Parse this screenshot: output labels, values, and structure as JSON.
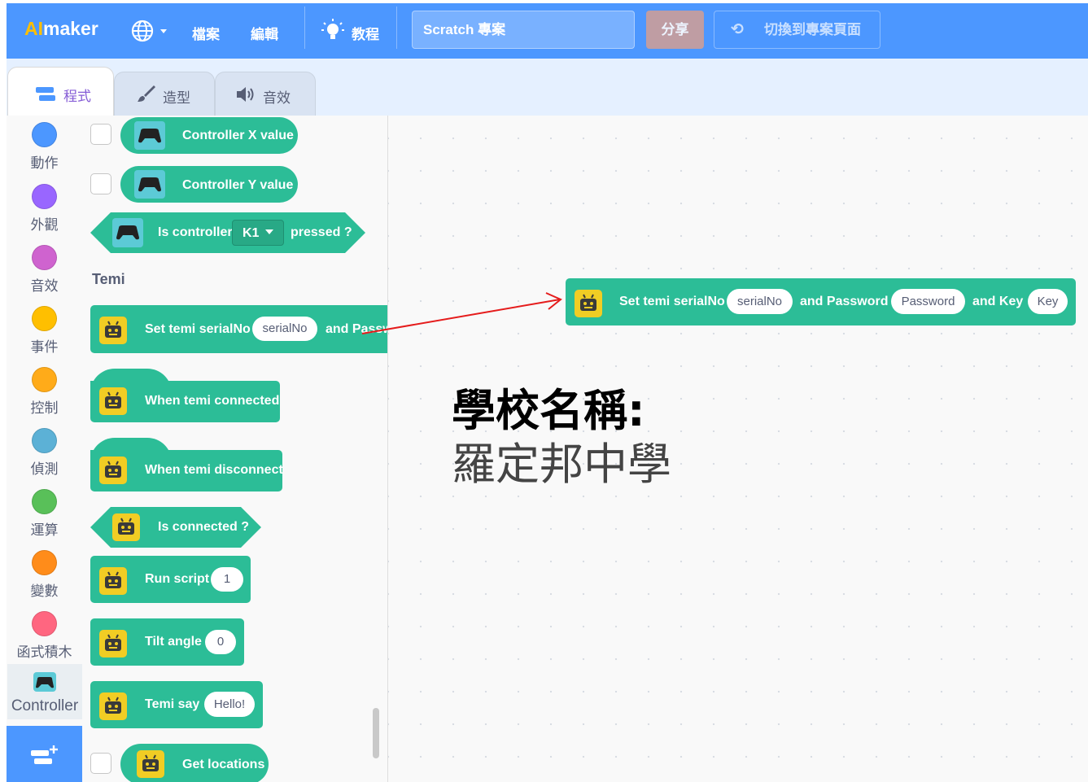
{
  "menubar": {
    "logo_ai": "AI",
    "logo_rest": "maker",
    "items": {
      "file": "檔案",
      "edit": "編輯",
      "tutorials": "教程"
    },
    "project_title": "Scratch 專案",
    "share": "分享",
    "see_project": "切換到專案頁面",
    "colors": {
      "bar": "#4c97ff",
      "logo_ai": "#ffbf00",
      "share_bg": "#cc9e9a"
    }
  },
  "tabs": [
    {
      "label": "程式",
      "icon": "code-icon",
      "active": true
    },
    {
      "label": "造型",
      "icon": "brush-icon",
      "active": false
    },
    {
      "label": "音效",
      "icon": "speaker-icon",
      "active": false
    }
  ],
  "categories": [
    {
      "label": "動作",
      "color": "#4c97ff"
    },
    {
      "label": "外觀",
      "color": "#9966ff"
    },
    {
      "label": "音效",
      "color": "#cf63cf"
    },
    {
      "label": "事件",
      "color": "#ffbf00"
    },
    {
      "label": "控制",
      "color": "#ffab19"
    },
    {
      "label": "偵測",
      "color": "#5cb1d6"
    },
    {
      "label": "運算",
      "color": "#59c059"
    },
    {
      "label": "變數",
      "color": "#ff8c1a"
    },
    {
      "label": "函式積木",
      "color": "#ff6680"
    },
    {
      "label": "Controller",
      "color": "#5ccad6",
      "icon": "gamepad-icon",
      "selected": true
    }
  ],
  "add_extension": "add-extension-icon",
  "palette": {
    "controller_x": "Controller X value",
    "controller_y": "Controller Y value",
    "is_controller": "Is controller",
    "is_controller_key": "K1",
    "pressed": "pressed ?",
    "temi_heading": "Temi",
    "set_temi": "Set temi serialNo",
    "set_temi_serial": "serialNo",
    "and_password_cut": "and Passw",
    "when_connected": "When temi connected",
    "when_disconnected": "When temi disconnect",
    "is_connected": "Is connected ?",
    "run_script": "Run script",
    "run_script_value": "1",
    "tilt_angle": "Tilt angle",
    "tilt_value": "0",
    "temi_say": "Temi say",
    "temi_say_value": "Hello!",
    "get_locations": "Get locations",
    "block_color": "#2cbd97"
  },
  "workspace_block": {
    "label1": "Set temi serialNo",
    "serial": "serialNo",
    "label2": "and Password",
    "password": "Password",
    "label3": "and Key",
    "key": "Key"
  },
  "annotation": {
    "school_label": "學校名稱:",
    "school_name": "羅定邦中學",
    "arrow_color": "#e51c1c"
  }
}
